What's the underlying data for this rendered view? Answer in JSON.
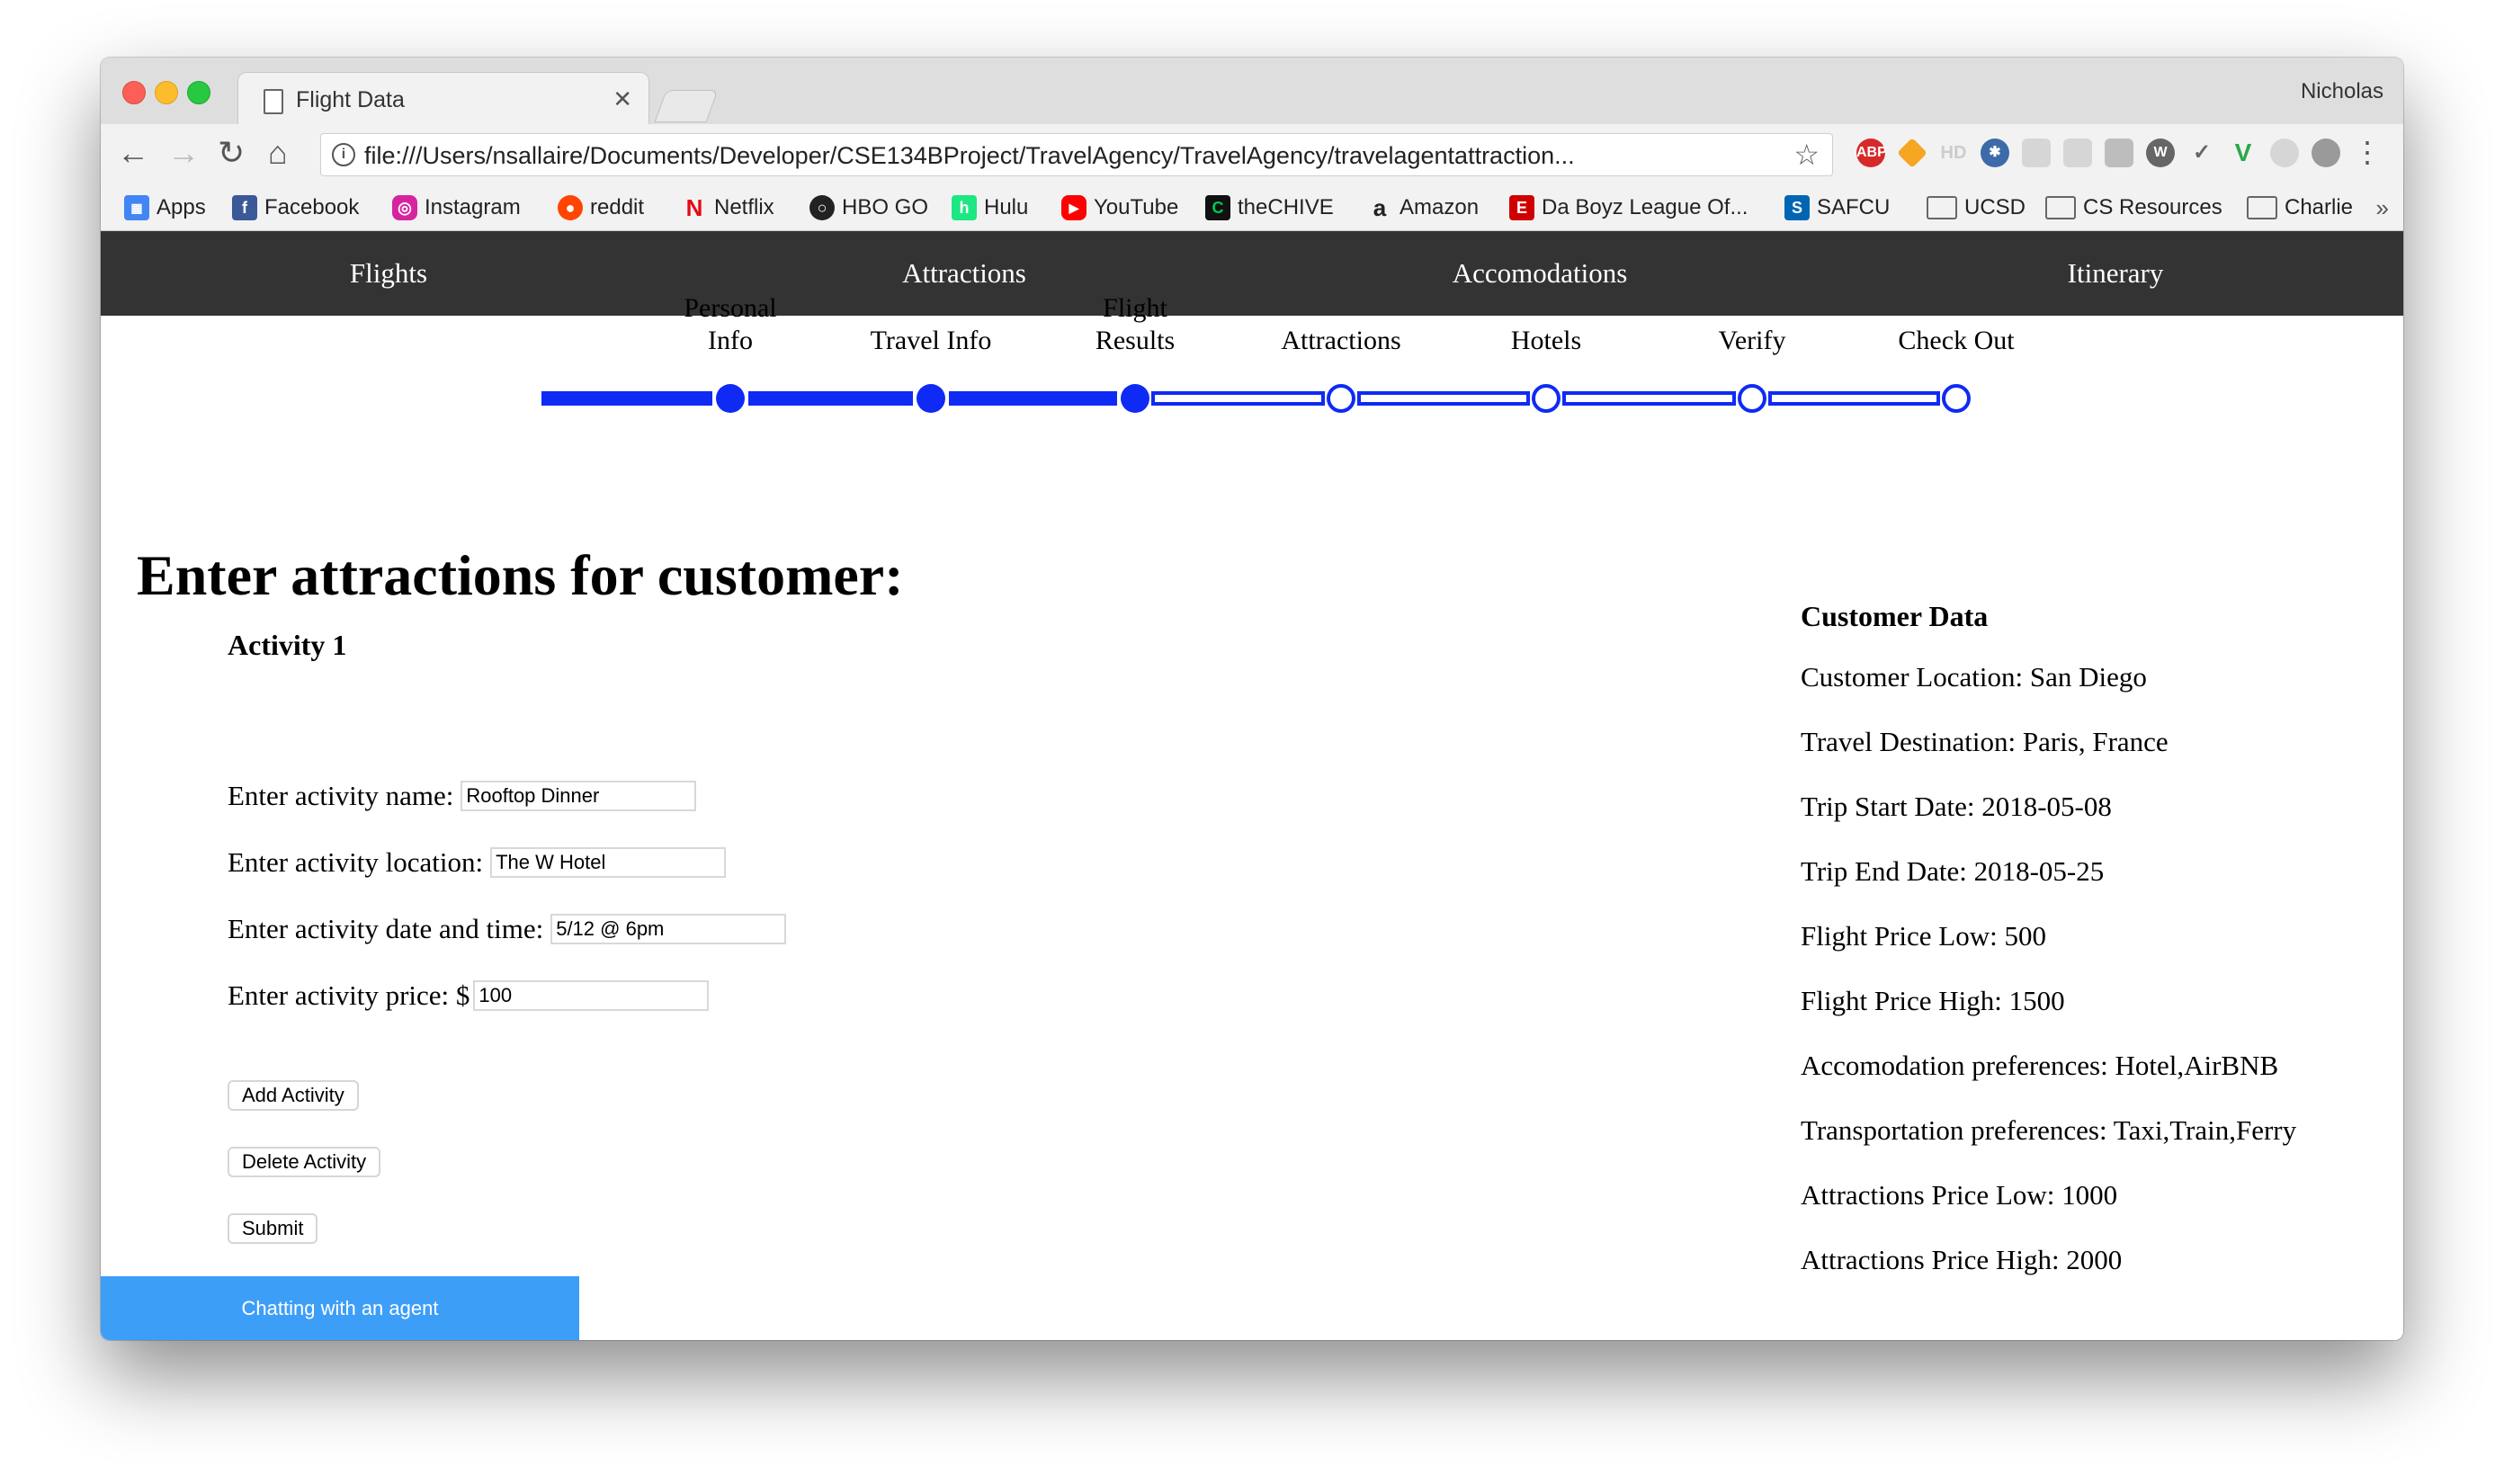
{
  "browser": {
    "tab_title": "Flight Data",
    "profile": "Nicholas",
    "url": "file:///Users/nsallaire/Documents/Developer/CSE134BProject/TravelAgency/TravelAgency/travelagentattraction..."
  },
  "bookmarks": [
    {
      "label": "Apps",
      "icon": "apps-icon",
      "color": "#4285f4"
    },
    {
      "label": "Facebook",
      "icon": "facebook-icon",
      "color": "#3b5998"
    },
    {
      "label": "Instagram",
      "icon": "instagram-icon",
      "color": "#d6249f"
    },
    {
      "label": "reddit",
      "icon": "reddit-icon",
      "color": "#ff4500"
    },
    {
      "label": "Netflix",
      "icon": "netflix-icon",
      "color": "#e50914"
    },
    {
      "label": "HBO GO",
      "icon": "hbo-icon",
      "color": "#222222"
    },
    {
      "label": "Hulu",
      "icon": "hulu-icon",
      "color": "#1ce783"
    },
    {
      "label": "YouTube",
      "icon": "youtube-icon",
      "color": "#ff0000"
    },
    {
      "label": "theCHIVE",
      "icon": "chive-icon",
      "color": "#00a651"
    },
    {
      "label": "Amazon",
      "icon": "amazon-icon",
      "color": "#222222"
    },
    {
      "label": "Da Boyz League Of...",
      "icon": "espn-icon",
      "color": "#d00000"
    },
    {
      "label": "SAFCU",
      "icon": "safcu-icon",
      "color": "#0066b3"
    },
    {
      "label": "UCSD",
      "icon": "folder-icon",
      "color": "#666666"
    },
    {
      "label": "CS Resources",
      "icon": "folder-icon",
      "color": "#666666"
    },
    {
      "label": "Charlie",
      "icon": "folder-icon",
      "color": "#666666"
    }
  ],
  "nav": {
    "flights": "Flights",
    "attractions": "Attractions",
    "accomodations": "Accomodations",
    "itinerary": "Itinerary"
  },
  "steps": [
    {
      "label": "Personal\nInfo",
      "completed": true
    },
    {
      "label": "Travel Info",
      "completed": true
    },
    {
      "label": "Flight\nResults",
      "completed": true
    },
    {
      "label": "Attractions",
      "completed": false
    },
    {
      "label": "Hotels",
      "completed": false
    },
    {
      "label": "Verify",
      "completed": false
    },
    {
      "label": "Check Out",
      "completed": false
    }
  ],
  "progress_color": "#0f2af5",
  "form": {
    "heading": "Enter attractions for customer:",
    "activity_title": "Activity 1",
    "name_label": "Enter activity name:",
    "name_value": "Rooftop Dinner",
    "location_label": "Enter activity location:",
    "location_value": "The W Hotel",
    "datetime_label": "Enter activity date and time:",
    "datetime_value": "5/12 @ 6pm",
    "price_label": "Enter activity price: $",
    "price_value": "100",
    "add_button": "Add Activity",
    "delete_button": "Delete Activity",
    "submit_button": "Submit"
  },
  "customer": {
    "title": "Customer Data",
    "items": [
      "Customer Location: San Diego",
      "Travel Destination: Paris, France",
      "Trip Start Date: 2018-05-08",
      "Trip End Date: 2018-05-25",
      "Flight Price Low: 500",
      "Flight Price High: 1500",
      "Accomodation preferences: Hotel,AirBNB",
      "Transportation preferences: Taxi,Train,Ferry",
      "Attractions Price Low: 1000",
      "Attractions Price High: 2000"
    ]
  },
  "chat": {
    "label": "Chatting with an agent",
    "color": "#3d9ef8"
  }
}
